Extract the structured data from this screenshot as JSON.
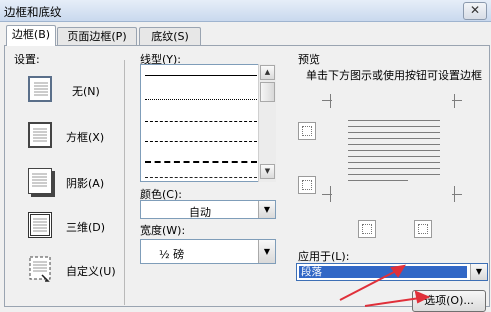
{
  "dialog": {
    "title": "边框和底纹",
    "close_label": "✕"
  },
  "tabs": [
    {
      "label": "边框(B)",
      "active": true
    },
    {
      "label": "页面边框(P)",
      "active": false
    },
    {
      "label": "底纹(S)",
      "active": false
    }
  ],
  "setting": {
    "label": "设置:",
    "items": [
      {
        "label": "无(N)",
        "icon": "setting-none-icon"
      },
      {
        "label": "方框(X)",
        "icon": "setting-box-icon"
      },
      {
        "label": "阴影(A)",
        "icon": "setting-shadow-icon"
      },
      {
        "label": "三维(D)",
        "icon": "setting-3d-icon"
      },
      {
        "label": "自定义(U)",
        "icon": "setting-custom-icon"
      }
    ]
  },
  "style": {
    "label": "线型(Y):",
    "lines": [
      "solid",
      "dotted",
      "dashed-small",
      "dashed",
      "dashed-long",
      "dash-dot"
    ]
  },
  "color": {
    "label": "颜色(C):",
    "value": "自动"
  },
  "width": {
    "label": "宽度(W):",
    "value": "½ 磅"
  },
  "preview": {
    "label": "预览",
    "hint": "单击下方图示或使用按钮可设置边框"
  },
  "apply_to": {
    "label": "应用于(L):",
    "value": "段落"
  },
  "options_button": "选项(O)...",
  "colors": {
    "selection": "#3167c6",
    "arrow": "#e0303a"
  }
}
